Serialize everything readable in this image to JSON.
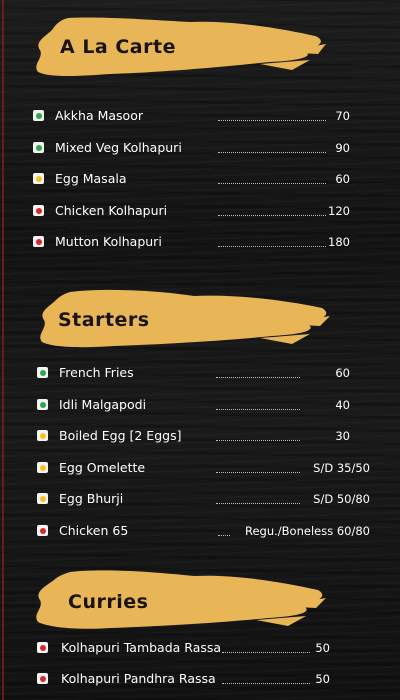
{
  "colors": {
    "banner": "#e8b557",
    "veg": "#2fa84a",
    "egg": "#f2c61f",
    "nonveg": "#d9262c",
    "mark_bg": "#f4f4f4"
  },
  "sections": [
    {
      "title": "A La Carte",
      "items": [
        {
          "name": "Akkha Masoor",
          "dots": "......................................",
          "price": "70",
          "type": "veg"
        },
        {
          "name": "Mixed Veg Kolhapuri",
          "dots": "......................................",
          "price": "90",
          "type": "veg"
        },
        {
          "name": "Egg Masala",
          "dots": "......................................",
          "price": "60",
          "type": "egg"
        },
        {
          "name": "Chicken Kolhapuri",
          "dots": "......................................",
          "price": "120",
          "type": "nonveg"
        },
        {
          "name": "Mutton Kolhapuri",
          "dots": "......................................",
          "price": "180",
          "type": "nonveg"
        }
      ]
    },
    {
      "title": "Starters",
      "items": [
        {
          "name": "French Fries",
          "dots": "......................................",
          "price": "60",
          "type": "veg"
        },
        {
          "name": "Idli Malgapodi",
          "dots": "......................................",
          "price": "40",
          "type": "veg"
        },
        {
          "name": "Boiled Egg [2 Eggs]",
          "dots": "......................................",
          "price": "30",
          "type": "egg"
        },
        {
          "name": "Egg Omelette",
          "dots": "......................................",
          "price": "S/D 35/50",
          "type": "egg"
        },
        {
          "name": "Egg Bhurji",
          "dots": "......................................",
          "price": "S/D 50/80",
          "type": "egg"
        },
        {
          "name": "Chicken 65",
          "dots": "....",
          "price": "Regu./Boneless 60/80",
          "type": "nonveg"
        }
      ]
    },
    {
      "title": "Curries",
      "items": [
        {
          "name": "Kolhapuri Tambada Rassa",
          "dots": "......................................",
          "price": "50",
          "type": "nonveg"
        },
        {
          "name": "Kolhapuri Pandhra Rassa",
          "dots": "......................................",
          "price": "50",
          "type": "nonveg"
        }
      ]
    }
  ]
}
